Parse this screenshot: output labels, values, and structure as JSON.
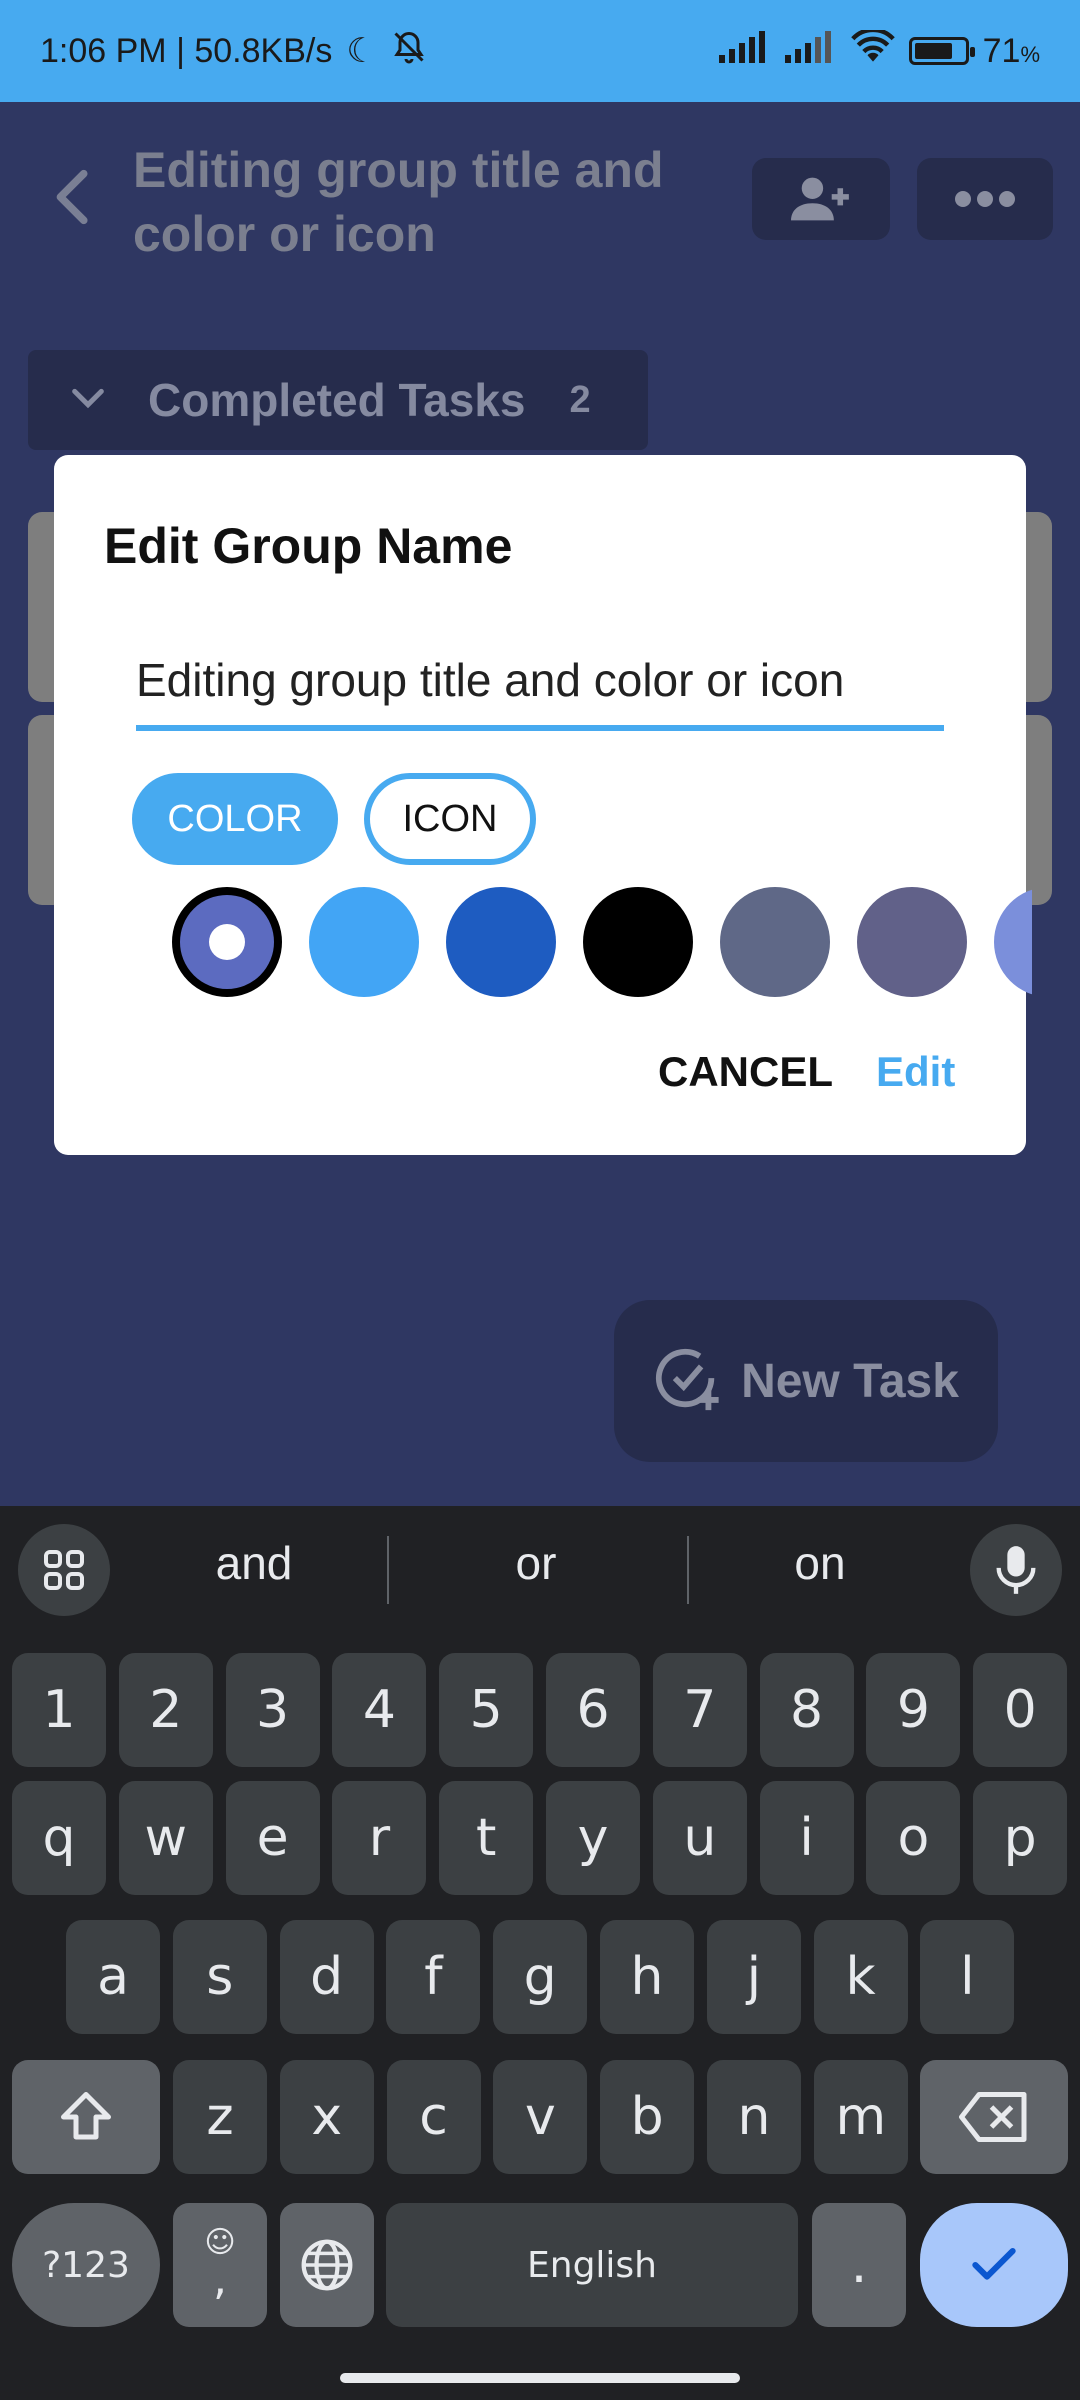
{
  "status_bar": {
    "time_speed": "1:06 PM | 50.8KB/s",
    "battery": "71",
    "battery_unit": "%"
  },
  "header": {
    "title": "Editing group title and color or icon"
  },
  "section": {
    "label": "Completed Tasks",
    "count": "2"
  },
  "fab": {
    "label": "New Task"
  },
  "dialog": {
    "title": "Edit Group Name",
    "input_value": "Editing group title and color or icon",
    "tabs": {
      "color": "COLOR",
      "icon": "ICON"
    },
    "swatches": [
      "#5c6bc0",
      "#42a5f5",
      "#1e5cc1",
      "#000000",
      "#5f6887",
      "#616189",
      "#7b8fdb"
    ],
    "selected_swatch": 0,
    "cancel": "CANCEL",
    "confirm": "Edit"
  },
  "keyboard": {
    "suggestions": [
      "and",
      "or",
      "on"
    ],
    "row_numbers": [
      "1",
      "2",
      "3",
      "4",
      "5",
      "6",
      "7",
      "8",
      "9",
      "0"
    ],
    "row1": [
      "q",
      "w",
      "e",
      "r",
      "t",
      "y",
      "u",
      "i",
      "o",
      "p"
    ],
    "row2": [
      "a",
      "s",
      "d",
      "f",
      "g",
      "h",
      "j",
      "k",
      "l"
    ],
    "row3": [
      "z",
      "x",
      "c",
      "v",
      "b",
      "n",
      "m"
    ],
    "symbols": "?123",
    "comma": ",",
    "space": "English",
    "period": "."
  },
  "colors": {
    "accent": "#47aaf0",
    "background": "#2f3762"
  }
}
